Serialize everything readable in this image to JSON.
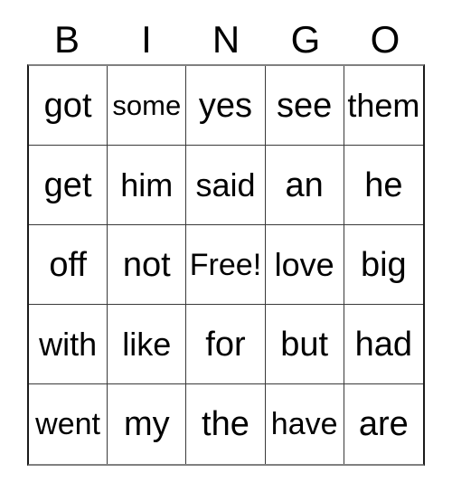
{
  "card": {
    "title_letters": [
      "B",
      "I",
      "N",
      "G",
      "O"
    ],
    "free_space_label": "Free!",
    "colors": {
      "background": "#ffffff",
      "text": "#000000",
      "grid_line": "#3a3a3a",
      "outer_border": "#1a1a1a"
    },
    "grid": {
      "columns": 5,
      "rows": 5,
      "cells": [
        [
          {
            "text": "got",
            "fit": ""
          },
          {
            "text": "some",
            "fit": "fit-sm"
          },
          {
            "text": "yes",
            "fit": ""
          },
          {
            "text": "see",
            "fit": ""
          },
          {
            "text": "them",
            "fit": "fit-lg"
          }
        ],
        [
          {
            "text": "get",
            "fit": ""
          },
          {
            "text": "him",
            "fit": "fit-lg"
          },
          {
            "text": "said",
            "fit": "fit-lg"
          },
          {
            "text": "an",
            "fit": ""
          },
          {
            "text": "he",
            "fit": ""
          }
        ],
        [
          {
            "text": "off",
            "fit": ""
          },
          {
            "text": "not",
            "fit": ""
          },
          {
            "text": "Free!",
            "fit": "fit-md"
          },
          {
            "text": "love",
            "fit": "fit-lg"
          },
          {
            "text": "big",
            "fit": ""
          }
        ],
        [
          {
            "text": "with",
            "fit": "fit-lg"
          },
          {
            "text": "like",
            "fit": "fit-lg"
          },
          {
            "text": "for",
            "fit": ""
          },
          {
            "text": "but",
            "fit": ""
          },
          {
            "text": "had",
            "fit": ""
          }
        ],
        [
          {
            "text": "went",
            "fit": "fit-md"
          },
          {
            "text": "my",
            "fit": ""
          },
          {
            "text": "the",
            "fit": ""
          },
          {
            "text": "have",
            "fit": "fit-md"
          },
          {
            "text": "are",
            "fit": ""
          }
        ]
      ]
    }
  }
}
